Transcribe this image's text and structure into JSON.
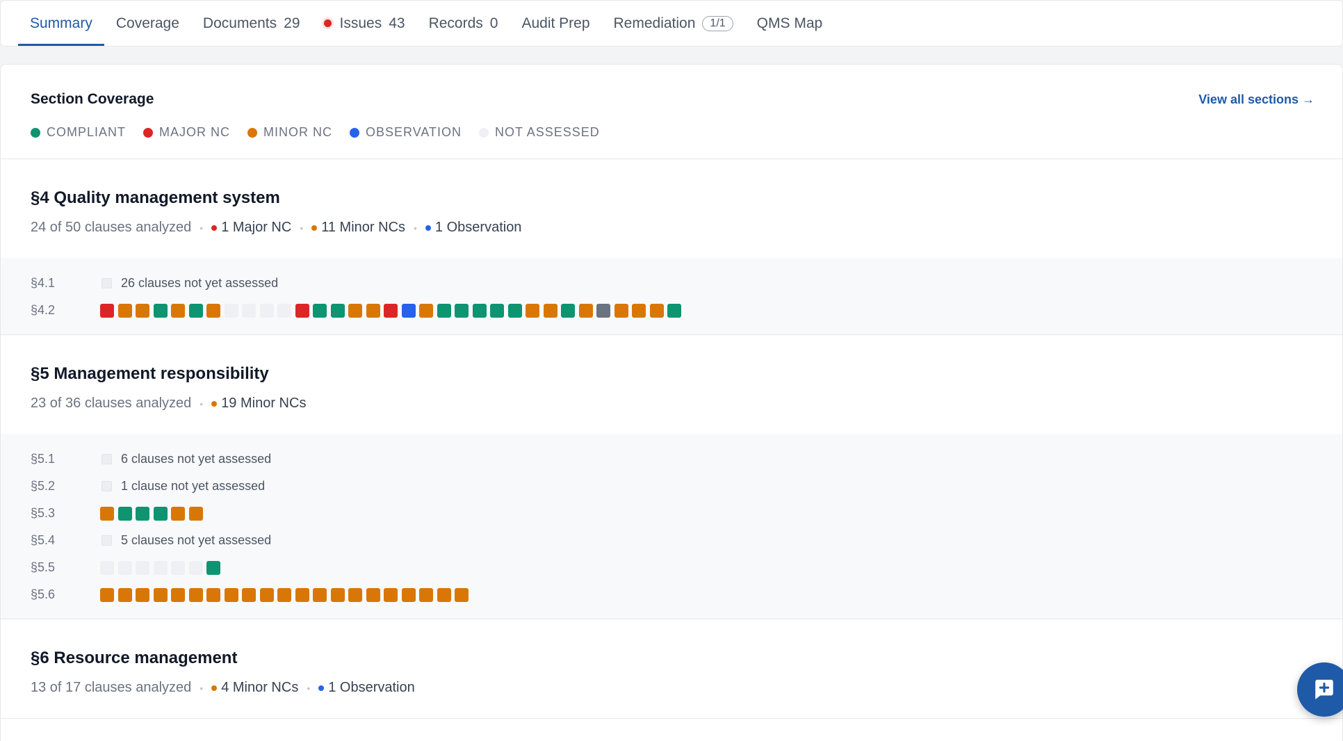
{
  "tabs": {
    "summary": "Summary",
    "coverage": "Coverage",
    "documents": {
      "label": "Documents",
      "count": "29"
    },
    "issues": {
      "label": "Issues",
      "count": "43"
    },
    "records": {
      "label": "Records",
      "count": "0"
    },
    "audit_prep": "Audit Prep",
    "remediation": {
      "label": "Remediation",
      "badge": "1/1"
    },
    "qms_map": "QMS Map"
  },
  "panel": {
    "title": "Section Coverage",
    "view_all": "View all sections →",
    "legend": {
      "compliant": "COMPLIANT",
      "major": "MAJOR NC",
      "minor": "MINOR NC",
      "observation": "OBSERVATION",
      "not_assessed": "NOT ASSESSED"
    }
  },
  "colors": {
    "C": "#0e9471",
    "X": "#dc2626",
    "M": "#d97706",
    "O": "#2563eb",
    "N": "#eef0f3",
    "G": "#6b7280",
    "accent": "#1e5aa8"
  },
  "sections": {
    "s4": {
      "title": "§4 Quality management system",
      "analyzed": "24 of 50 clauses analyzed",
      "major": "1 Major NC",
      "minor": "11 Minor NCs",
      "observation": "1 Observation",
      "rows": {
        "r41": {
          "label": "§4.1",
          "note": "26 clauses not yet assessed"
        },
        "r42": {
          "label": "§4.2",
          "cells": "XMMCMCMNNNNXCCMMXOMCCCCCMMCMGMMMC"
        }
      }
    },
    "s5": {
      "title": "§5 Management responsibility",
      "analyzed": "23 of 36 clauses analyzed",
      "minor": "19 Minor NCs",
      "rows": {
        "r51": {
          "label": "§5.1",
          "note": "6 clauses not yet assessed"
        },
        "r52": {
          "label": "§5.2",
          "note": "1 clause not yet assessed"
        },
        "r53": {
          "label": "§5.3",
          "cells": "MCCCMM"
        },
        "r54": {
          "label": "§5.4",
          "note": "5 clauses not yet assessed"
        },
        "r55": {
          "label": "§5.5",
          "cells": "NNNNNNC"
        },
        "r56": {
          "label": "§5.6",
          "cells": "MMMMMMMMMMMMMMMMMMMMM"
        }
      }
    },
    "s6": {
      "title": "§6 Resource management",
      "analyzed": "13 of 17 clauses analyzed",
      "minor": "4 Minor NCs",
      "observation": "1 Observation"
    }
  },
  "fab": {
    "icon": "add-comment-icon"
  }
}
